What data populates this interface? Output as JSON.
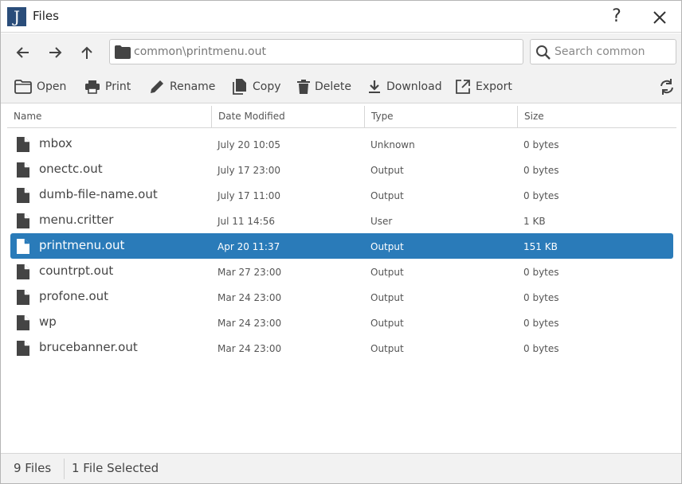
{
  "window": {
    "title": "Files",
    "logo_letter": "J"
  },
  "nav": {
    "path_value": "common\\printmenu.out",
    "search_placeholder": "Search common"
  },
  "toolbar": {
    "open": "Open",
    "print": "Print",
    "rename": "Rename",
    "copy": "Copy",
    "delete": "Delete",
    "download": "Download",
    "export": "Export"
  },
  "columns": {
    "name": "Name",
    "date": "Date Modified",
    "type": "Type",
    "size": "Size"
  },
  "files": [
    {
      "name": "mbox",
      "date": "July 20 10:05",
      "type": "Unknown",
      "size": "0 bytes",
      "selected": false
    },
    {
      "name": "onectc.out",
      "date": "July 17 23:00",
      "type": "Output",
      "size": "0 bytes",
      "selected": false
    },
    {
      "name": "dumb-file-name.out",
      "date": "July 17 11:00",
      "type": "Output",
      "size": "0 bytes",
      "selected": false
    },
    {
      "name": "menu.critter",
      "date": "Jul 11 14:56",
      "type": "User",
      "size": "1 KB",
      "selected": false
    },
    {
      "name": "printmenu.out",
      "date": "Apr 20 11:37",
      "type": "Output",
      "size": "151 KB",
      "selected": true
    },
    {
      "name": "countrpt.out",
      "date": "Mar 27 23:00",
      "type": "Output",
      "size": "0 bytes",
      "selected": false
    },
    {
      "name": "profone.out",
      "date": "Mar 24 23:00",
      "type": "Output",
      "size": "0 bytes",
      "selected": false
    },
    {
      "name": "wp",
      "date": "Mar 24 23:00",
      "type": "Output",
      "size": "0 bytes",
      "selected": false
    },
    {
      "name": "brucebanner.out",
      "date": "Mar 24 23:00",
      "type": "Output",
      "size": "0 bytes",
      "selected": false
    }
  ],
  "status": {
    "file_count": "9 Files",
    "selection": "1 File Selected"
  },
  "colors": {
    "selection": "#2a7bb9",
    "logo": "#2a4d7a",
    "toolbar_bg": "#f2f2f2",
    "icon": "#444444"
  },
  "icons": {
    "logo": "j-logo-icon",
    "help": "help-icon",
    "close": "close-icon",
    "back": "arrow-left-icon",
    "forward": "arrow-right-icon",
    "up": "arrow-up-icon",
    "folder": "folder-icon",
    "search": "search-icon",
    "open": "folder-open-icon",
    "print": "printer-icon",
    "rename": "pencil-icon",
    "copy": "copy-icon",
    "delete": "trash-icon",
    "download": "download-icon",
    "export": "export-icon",
    "refresh": "refresh-icon",
    "file": "file-icon"
  }
}
